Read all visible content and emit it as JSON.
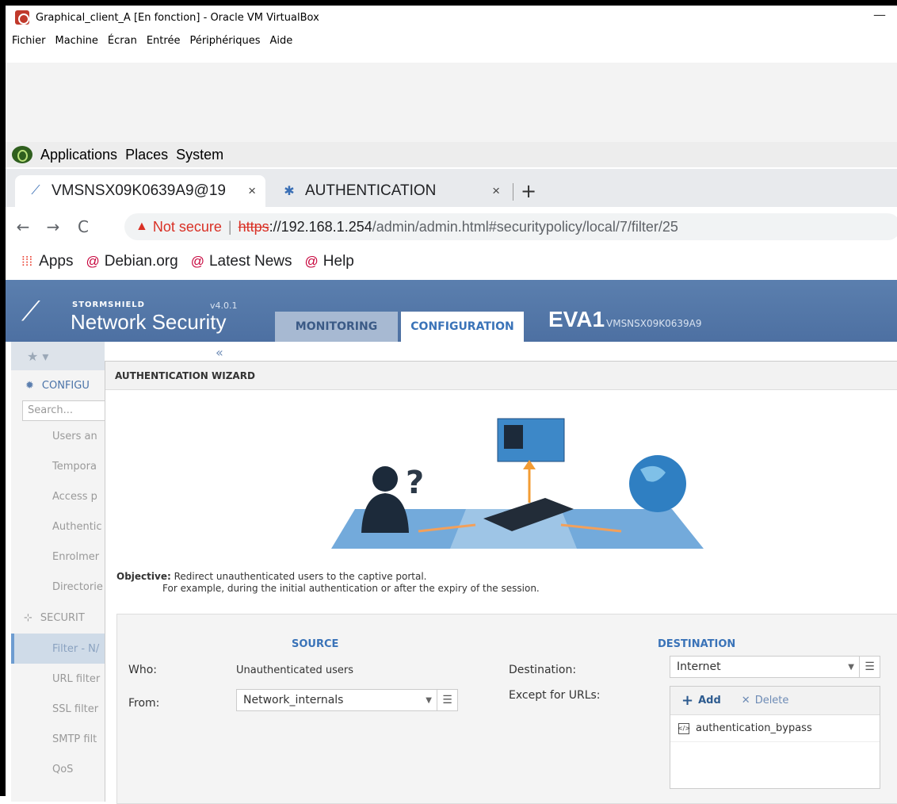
{
  "vbox": {
    "title": "Graphical_client_A [En fonction] - Oracle VM VirtualBox",
    "minimize": "—",
    "menu": [
      "Fichier",
      "Machine",
      "Écran",
      "Entrée",
      "Périphériques",
      "Aide"
    ]
  },
  "gnome": {
    "items": [
      "Applications",
      "Places",
      "System"
    ]
  },
  "browser": {
    "tabs": [
      {
        "label": "VMSNSX09K0639A9@19",
        "close": "×"
      },
      {
        "label": "AUTHENTICATION",
        "close": "×"
      }
    ],
    "new_tab": "+",
    "nav": {
      "back": "←",
      "forward": "→",
      "reload": "C"
    },
    "not_secure": "Not secure",
    "url_scheme": "https",
    "url_host": "://192.168.1.254",
    "url_path": "/admin/admin.html#securitypolicy/local/7/filter/25",
    "bookmarks": [
      "Apps",
      "Debian.org",
      "Latest News",
      "Help"
    ]
  },
  "sns": {
    "brand_small": "STORMSHIELD",
    "brand_large": "Network Security",
    "version": "v4.0.1",
    "tabs": [
      "MONITORING",
      "CONFIGURATION"
    ],
    "device": "EVA1",
    "serial": "VMSNSX09K0639A9"
  },
  "sidebar": {
    "star": "★ ▾",
    "collapse": "«",
    "config_label": "CONFIGU",
    "search_placeholder": "Search...",
    "items": [
      "Users an",
      "Tempora",
      "Access p",
      "Authentic",
      "Enrolmer",
      "Directorie"
    ],
    "security_label": "SECURIT",
    "security_items": [
      "Filter - N/",
      "URL filter",
      "SSL filter",
      "SMTP filt",
      "QoS"
    ]
  },
  "wizard": {
    "title": "AUTHENTICATION WIZARD",
    "objective_label": "Objective:",
    "objective_line1": "Redirect unauthenticated users to the captive portal.",
    "objective_line2": "For example, during the initial authentication or after the expiry of the session.",
    "source_heading": "SOURCE",
    "destination_heading": "DESTINATION",
    "who_label": "Who:",
    "who_value": "Unauthenticated users",
    "from_label": "From:",
    "from_value": "Network_internals",
    "destination_label": "Destination:",
    "destination_value": "Internet",
    "except_label": "Except for URLs:",
    "add_label": "Add",
    "delete_label": "Delete",
    "except_items": [
      "authentication_bypass"
    ]
  },
  "colors": {
    "sns_header": "#5b7fae",
    "accent_blue": "#3a73b8",
    "not_secure_red": "#d93025"
  }
}
